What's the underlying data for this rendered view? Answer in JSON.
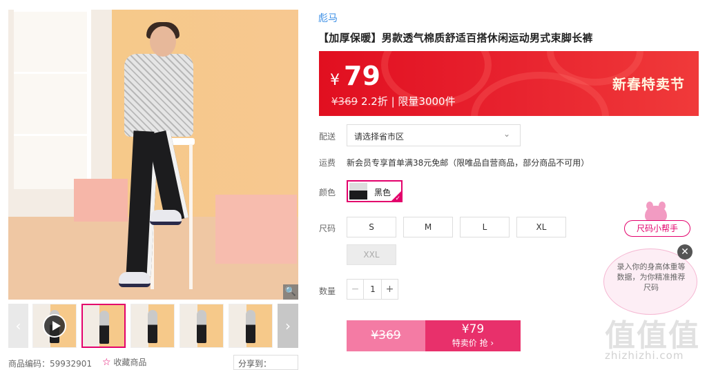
{
  "product": {
    "brand": "彪马",
    "title": "【加厚保暖】男款透气棉质舒适百搭休闲运动男式束脚长裤",
    "price_symbol": "¥",
    "price": "79",
    "original_price": "¥369",
    "discount_info": " 2.2折 | 限量3000件",
    "promo_label": "新春特卖节"
  },
  "delivery": {
    "label": "配送",
    "placeholder": "请选择省市区",
    "chevron": "chevron-down-icon"
  },
  "shipping": {
    "label": "运费",
    "text": "新会员专享首单满38元免邮（限唯品自营商品，部分商品不可用）"
  },
  "color": {
    "label": "颜色",
    "selected": "黑色"
  },
  "sizes": {
    "label": "尺码",
    "options": [
      "S",
      "M",
      "L",
      "XL",
      "XXL"
    ],
    "disabled": [
      "XXL"
    ]
  },
  "quantity": {
    "label": "数量",
    "minus": "−",
    "value": "1",
    "plus": "+"
  },
  "buy": {
    "original_price": "¥369",
    "sale_price": "¥79",
    "sale_label": "特卖价 抢 ›"
  },
  "helper": {
    "tag": "尺码小帮手",
    "bubble_text": "录入你的身高体重等数据，为你精准推荐尺码",
    "close": "✕"
  },
  "gallery": {
    "zoom_icon": "🔍",
    "prev_arrow": "‹",
    "next_arrow": "›"
  },
  "meta": {
    "sku": "商品编码：59932901",
    "favorite": "收藏商品",
    "star": "☆",
    "share": "分享到："
  },
  "watermark": {
    "logo": "值值值",
    "url": "zhizhizhi.com"
  },
  "colors": {
    "accent": "#e3006b",
    "banner_red": "#e10f20",
    "brand_blue": "#3a8ee6"
  }
}
